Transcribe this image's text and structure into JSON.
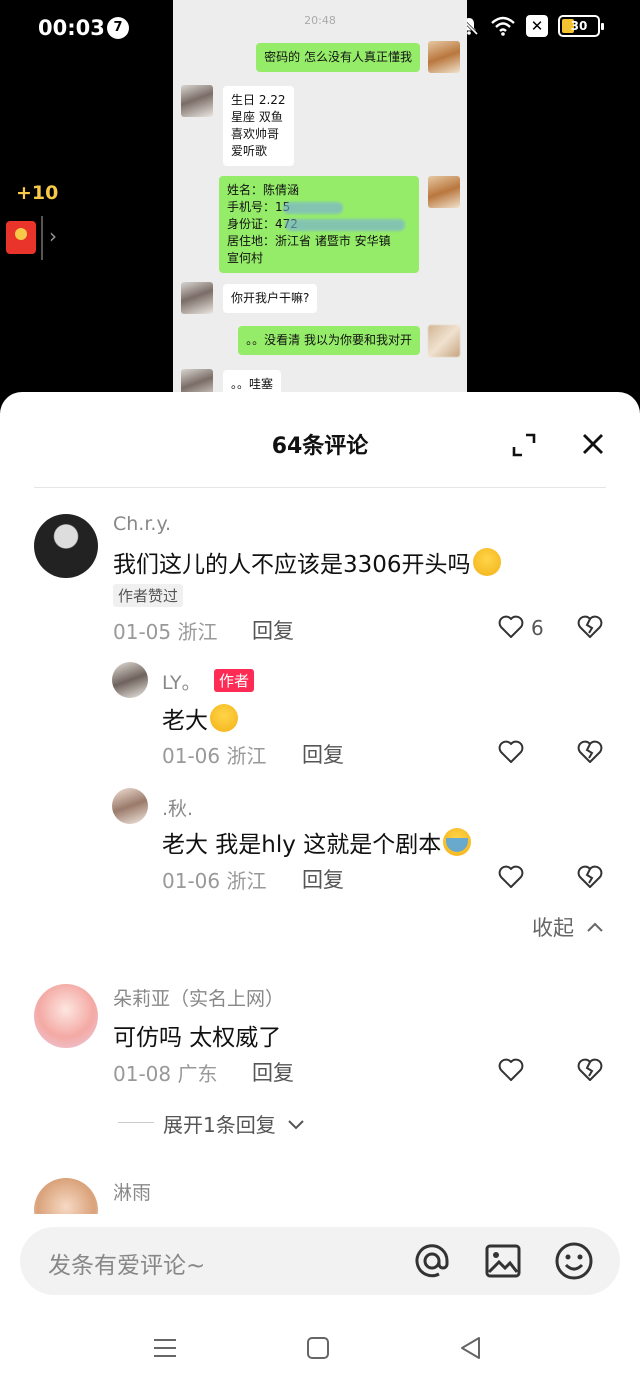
{
  "status_bar": {
    "time": "00:03",
    "notification_count": "7",
    "battery": "30"
  },
  "reward": {
    "amount": "+10"
  },
  "chat_screenshot": {
    "timestamp": "20:48",
    "messages": [
      {
        "side": "right",
        "text": "密码的 怎么没有人真正懂我"
      },
      {
        "side": "left",
        "text": "生日 2.22\n星座 双鱼\n喜欢帅哥\n爱听歌"
      },
      {
        "side": "right",
        "text": "姓名：陈倩涵\n手机号：15\n身份证：472\n居住地：浙江省 诸暨市 安华镇\n宣何村"
      },
      {
        "side": "left",
        "text": "你开我户干嘛?"
      },
      {
        "side": "right",
        "text": "。。没看清 我以为你要和我对开"
      },
      {
        "side": "left",
        "text": "。。哇塞"
      }
    ]
  },
  "panel": {
    "title": "64条评论",
    "comments": [
      {
        "name": "Ch.r.y.",
        "text": "我们这儿的人不应该是3306开头吗",
        "tag": "作者赞过",
        "date": "01-05 浙江",
        "reply": "回复",
        "likes": "6"
      },
      {
        "name": "LY。",
        "author_tag": "作者",
        "text": "老大",
        "date": "01-06 浙江",
        "reply": "回复"
      },
      {
        "name": ".秋.",
        "text": "老大 我是hly 这就是个剧本",
        "date": "01-06 浙江",
        "reply": "回复"
      },
      {
        "name": "朵莉亚（实名上网）",
        "text": "可仿吗 太权威了",
        "date": "01-08 广东",
        "reply": "回复"
      },
      {
        "name": "淋雨"
      }
    ],
    "collapse_label": "收起",
    "expand_replies_label": "展开1条回复"
  },
  "input": {
    "placeholder": "发条有爱评论~"
  },
  "colors": {
    "bubble_green": "#95ec69",
    "author_tag": "#fe2c55",
    "reward_red": "#e8342b",
    "reward_gold": "#f7c948"
  },
  "icons": [
    "mute-bell-icon",
    "wifi-icon",
    "close-box-icon",
    "battery-icon",
    "red-envelope-icon",
    "chevron-right-icon",
    "expand-icon",
    "close-icon",
    "heart-icon",
    "broken-heart-icon",
    "chevron-up-icon",
    "chevron-down-icon",
    "at-icon",
    "image-icon",
    "emoji-icon",
    "nav-menu-icon",
    "nav-home-icon",
    "nav-back-icon"
  ]
}
